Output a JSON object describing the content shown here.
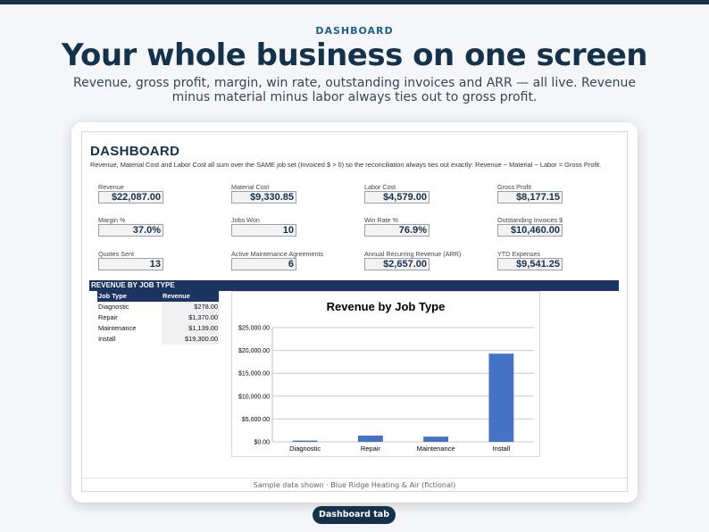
{
  "eyebrow": "DASHBOARD",
  "headline": "Your whole business on one screen",
  "subhead": "Revenue, gross profit, margin, win rate, outstanding invoices and ARR — all live. Revenue minus material minus labor always ties out to gross profit.",
  "sheet": {
    "title": "DASHBOARD",
    "note": "Revenue, Material Cost and Labor Cost all sum over the SAME job set (Invoiced $ > 0) so the reconciliation always ties out exactly: Revenue − Material − Labor = Gross Profit.",
    "kpis": [
      {
        "label": "Revenue",
        "value": "$22,087.00"
      },
      {
        "label": "Material Cost",
        "value": "$9,330.85"
      },
      {
        "label": "Labor Cost",
        "value": "$4,579.00"
      },
      {
        "label": "Gross Profit",
        "value": "$8,177.15"
      },
      {
        "label": "Margin %",
        "value": "37.0%"
      },
      {
        "label": "Jobs Won",
        "value": "10"
      },
      {
        "label": "Win Rate %",
        "value": "76.9%"
      },
      {
        "label": "Outstanding Invoices $",
        "value": "$10,460.00"
      },
      {
        "label": "Quotes Sent",
        "value": "13"
      },
      {
        "label": "Active Maintenance Agreements",
        "value": "6"
      },
      {
        "label": "Annual Recurring Revenue (ARR)",
        "value": "$2,657.00"
      },
      {
        "label": "YTD Expenses",
        "value": "$9,541.25"
      }
    ],
    "section_title": "REVENUE BY JOB TYPE",
    "table": {
      "headers": [
        "Job Type",
        "Revenue"
      ],
      "rows": [
        [
          "Diagnostic",
          "$278.00"
        ],
        [
          "Repair",
          "$1,370.00"
        ],
        [
          "Maintenance",
          "$1,139.00"
        ],
        [
          "Install",
          "$19,300.00"
        ]
      ]
    },
    "footer": "Sample data shown · Blue Ridge Heating & Air (fictional)"
  },
  "chart_data": {
    "type": "bar",
    "title": "Revenue by Job Type",
    "categories": [
      "Diagnostic",
      "Repair",
      "Maintenance",
      "Install"
    ],
    "values": [
      278,
      1370,
      1139,
      19300
    ],
    "ylim": [
      0,
      25000
    ],
    "yticks": [
      "$0.00",
      "$5,000.00",
      "$10,000.00",
      "$15,000.00",
      "$20,000.00",
      "$25,000.00"
    ],
    "grid": true,
    "bar_color": "#4472c4"
  },
  "tab_label": "Dashboard tab"
}
